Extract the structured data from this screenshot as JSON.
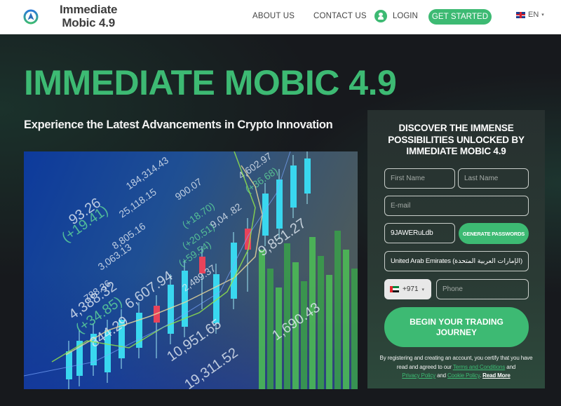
{
  "header": {
    "brand_line1": "Immediate",
    "brand_line2": "Mobic 4.9",
    "logo_icon": "compass-logo-icon",
    "nav": {
      "about": "ABOUT US",
      "contact": "CONTACT US",
      "login": "LOGIN",
      "login_icon": "user-icon",
      "get_started": "GET STARTED"
    },
    "language": {
      "flag": "uk-flag-icon",
      "code": "EN",
      "caret": "▾"
    }
  },
  "hero": {
    "title": "IMMEDIATE MOBIC 4.9",
    "subtitle": "Experience the Latest Advancements in Crypto Innovation",
    "image_alt": "Stock market trading chart display with candlesticks and price tickers",
    "image_tickers": [
      "184,314.43",
      "900.07",
      "25,118.15",
      "(+18.70)",
      "8,805.16",
      "(+20.51)",
      "3,063.13",
      "(+59.54)",
      "2,489.37",
      "4,602.97",
      "(+36.68)",
      "9,04 .82",
      "788.36",
      "4,388.32",
      "(+34.85)",
      "6,607.94",
      "844.29",
      "10,951.65",
      "9,851.27",
      "1,690.43",
      "19,311.52",
      "93.26",
      "(+19.41)"
    ]
  },
  "form": {
    "title": "DISCOVER THE IMMENSE POSSIBILITIES UNLOCKED BY IMMEDIATE MOBIC 4.9",
    "first_name_placeholder": "First Name",
    "last_name_placeholder": "Last Name",
    "email_placeholder": "E-mail",
    "password_value": "9JAWERuLdb",
    "generate_label": "GENERATE PASSWORDS",
    "country_value": "United Arab Emirates (الإمارات العربية المتحدة)",
    "phone_code": "+971",
    "phone_flag": "uae-flag-icon",
    "phone_caret": "▾",
    "phone_placeholder": "Phone",
    "submit_label": "BEGIN YOUR TRADING JOURNEY",
    "disclaimer": {
      "part1": "By registering and creating an account, you certify that you have read and agreed to our ",
      "terms": "Terms and Conditions",
      "part2": " and ",
      "privacy": "Privacy Policy",
      "part3": " and ",
      "cookie": "Cookie Policy",
      "part4": ". ",
      "read_more": "Read More"
    }
  },
  "colors": {
    "accent": "#3dba73",
    "background": "#17191d",
    "header_bg": "#ffffff",
    "panel_bg": "#2a3a34"
  }
}
